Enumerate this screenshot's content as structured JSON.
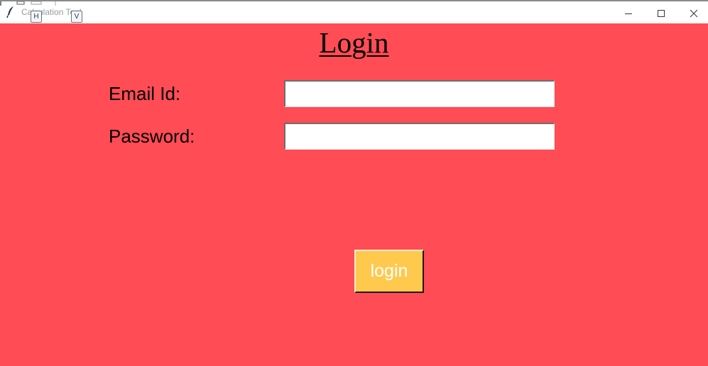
{
  "window": {
    "title": "Calculation Tool",
    "key_hints": [
      "H",
      "V"
    ],
    "controls": {
      "minimize_icon": "minimize-icon",
      "maximize_icon": "maximize-icon",
      "close_icon": "close-icon"
    }
  },
  "form": {
    "heading": "Login",
    "email_label": "Email Id:",
    "email_value": "",
    "password_label": "Password:",
    "password_value": "",
    "submit_label": "login"
  },
  "colors": {
    "background": "#ff4c55",
    "button": "#ffc94e",
    "button_text": "#ffffff",
    "titlebar": "#ffffff"
  }
}
